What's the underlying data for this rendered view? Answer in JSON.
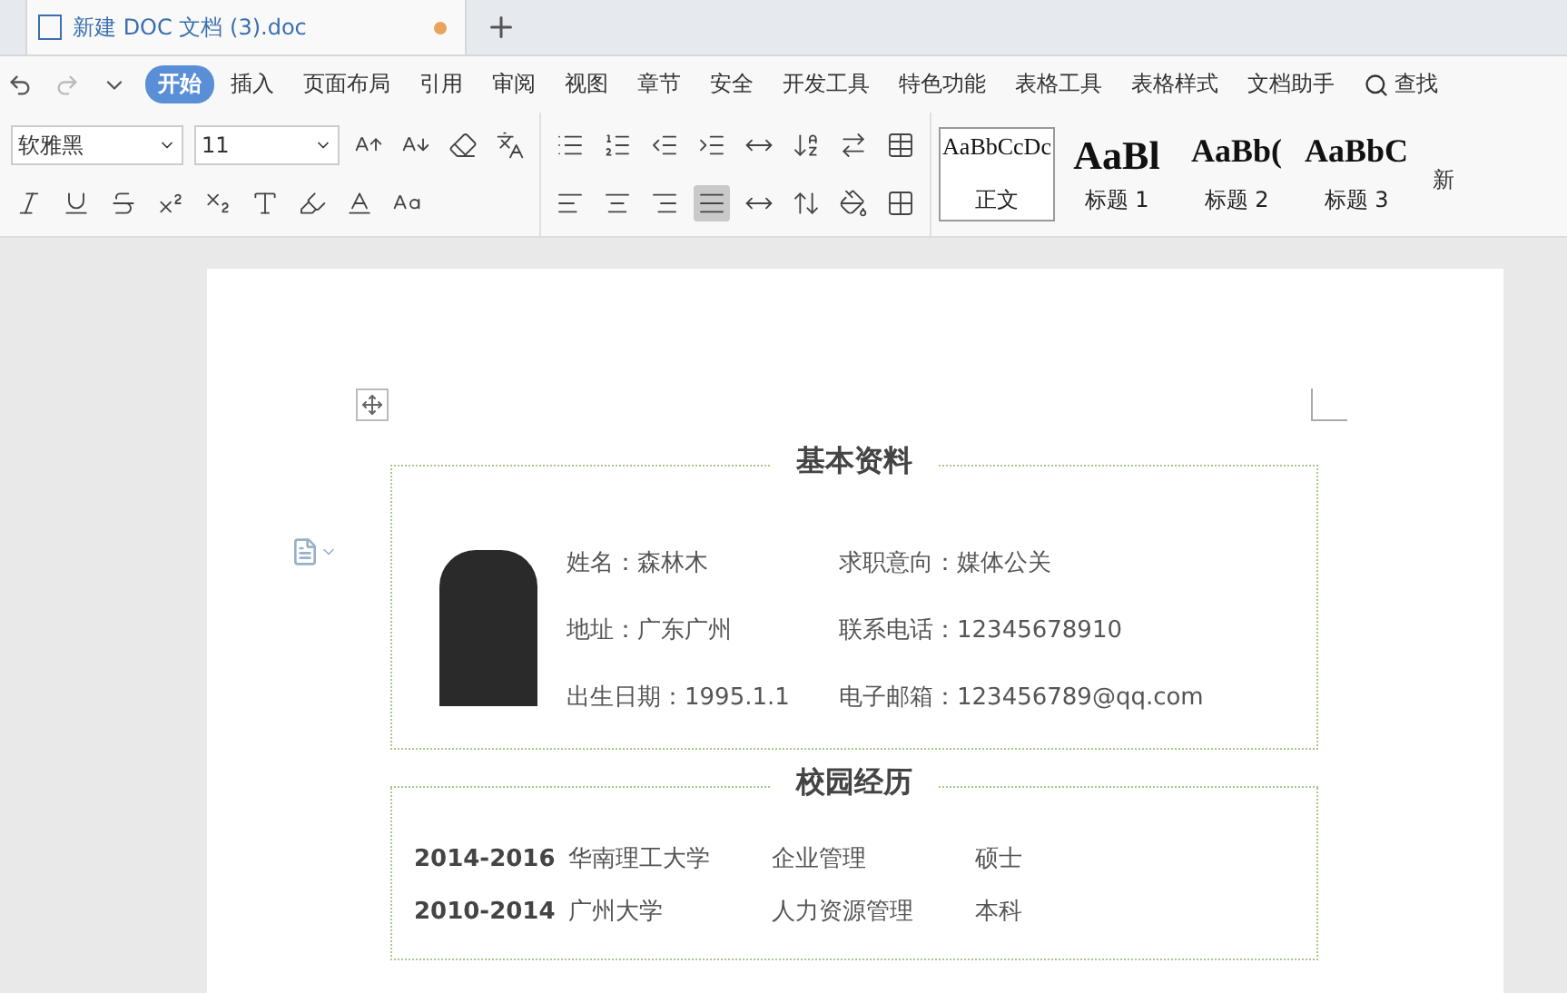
{
  "doc_tab": {
    "title": "新建 DOC 文档 (3).doc",
    "modified": true
  },
  "menu": [
    {
      "label": "开始",
      "selected": true
    },
    {
      "label": "插入",
      "selected": false
    },
    {
      "label": "页面布局",
      "selected": false
    },
    {
      "label": "引用",
      "selected": false
    },
    {
      "label": "审阅",
      "selected": false
    },
    {
      "label": "视图",
      "selected": false
    },
    {
      "label": "章节",
      "selected": false
    },
    {
      "label": "安全",
      "selected": false
    },
    {
      "label": "开发工具",
      "selected": false
    },
    {
      "label": "特色功能",
      "selected": false
    },
    {
      "label": "表格工具",
      "selected": false
    },
    {
      "label": "表格样式",
      "selected": false
    },
    {
      "label": "文档助手",
      "selected": false
    }
  ],
  "search_label": "查找",
  "font": {
    "name": "软雅黑",
    "size": "11"
  },
  "align_buttons": [
    {
      "selected": false
    },
    {
      "selected": false
    },
    {
      "selected": false
    },
    {
      "selected": true
    },
    {
      "selected": false
    }
  ],
  "styles": [
    {
      "preview": "AaBbCcDc",
      "label": "正文",
      "selected": true,
      "kind": "body"
    },
    {
      "preview": "AaBl",
      "label": "标题 1",
      "selected": false,
      "kind": "h1"
    },
    {
      "preview": "AaBb(",
      "label": "标题 2",
      "selected": false,
      "kind": "h2"
    },
    {
      "preview": "AaBbC",
      "label": "标题 3",
      "selected": false,
      "kind": "h3"
    }
  ],
  "new_style_label": "新",
  "basic_info": {
    "title": "基本资料",
    "fields": [
      {
        "label": "姓名：森林木"
      },
      {
        "label": "求职意向：媒体公关"
      },
      {
        "label": "地址：广东广州"
      },
      {
        "label": "联系电话：12345678910"
      },
      {
        "label": "出生日期：1995.1.1"
      },
      {
        "label": "电子邮箱：123456789@qq.com"
      }
    ]
  },
  "education": {
    "title": "校园经历",
    "rows": [
      {
        "years": "2014-2016",
        "school": "华南理工大学",
        "major": "企业管理",
        "degree": "硕士"
      },
      {
        "years": "2010-2014",
        "school": "广州大学",
        "major": "人力资源管理",
        "degree": "本科"
      }
    ]
  }
}
